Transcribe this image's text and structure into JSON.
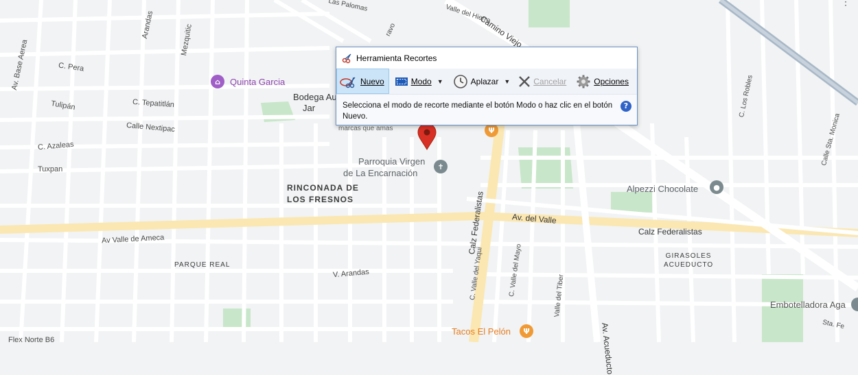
{
  "snipping_tool": {
    "title": "Herramienta Recortes",
    "buttons": {
      "new": "Nuevo",
      "mode": "Modo",
      "delay": "Aplazar",
      "cancel": "Cancelar",
      "options": "Opciones"
    },
    "message": "Selecciona el modo de recorte mediante el botón Modo o haz clic en el botón Nuevo.",
    "help_icon": "?"
  },
  "map": {
    "streets": {
      "av_base_aerea": "Av. Base Aerea",
      "c_pera": "C. Pera",
      "arandas_top": "Arandas",
      "mezquitic": "Mezquitic",
      "c_tepatitlan": "C. Tepatitlán",
      "tulipan": "Tulipán",
      "calle_nextipac": "Calle Nextipac",
      "c_azaleas": "C. Azaleas",
      "tuxpan": "Tuxpan",
      "av_valle_ameca": "Av Valle de Ameca",
      "v_arandas": "V. Arandas",
      "flex_norte": "Flex Norte B6",
      "calz_federalistas_v": "Calz Federalistas",
      "calz_federalistas_h": "Calz Federalistas",
      "av_del_valle": "Av. del Valle",
      "c_valle_yaqui": "C. Valle del Yaqui",
      "c_valle_mayo": "C. Valle del Mayo",
      "valle_tiber": "Valle del Tiber",
      "av_acueducto": "Av. Acueducto",
      "camino_viejo": "Camino Viejo",
      "valle_hierro": "Valle del Hierro",
      "las_palomas": "Las Palomas",
      "c_los_robles": "C. Los Robles",
      "calle_sta_monica": "Calle Sta. Monica",
      "sta_fe": "Sta. Fe",
      "ravo": "ravo",
      "marcas": "marcas que amas"
    },
    "neighborhoods": {
      "rinconada_1": "RINCONADA DE",
      "rinconada_2": "LOS FRESNOS",
      "parque_real": "PARQUE REAL",
      "girasoles_1": "GIRASOLES",
      "girasoles_2": "ACUEDUCTO"
    },
    "pois": {
      "quinta_garcia": "Quinta Garcia",
      "bodega": "Bodega Au",
      "jar": "Jar",
      "parroquia_1": "Parroquia Virgen",
      "parroquia_2": "de La Encarnación",
      "alpezzi": "Alpezzi Chocolate",
      "tacos": "Tacos El Pelón",
      "embotelladora": "Embotelladora Aga"
    },
    "more_menu": "⋮"
  },
  "colors": {
    "map_bg": "#f1f3f4",
    "road": "#ffffff",
    "park": "#c8e6c9",
    "major_road": "#fbe7b2",
    "snip_border": "#6b8fc2",
    "active_button": "#cce4f7",
    "pin_red": "#d93025"
  },
  "icons": {
    "snip_app": "scissors-icon",
    "new": "scissors-icon",
    "mode": "rectangle-icon",
    "delay": "clock-icon",
    "cancel": "x-icon",
    "options": "gear-icon",
    "help": "help-icon",
    "map_pin": "map-pin-icon",
    "church": "cross-icon",
    "restaurant": "fork-knife-icon",
    "place": "place-icon"
  }
}
